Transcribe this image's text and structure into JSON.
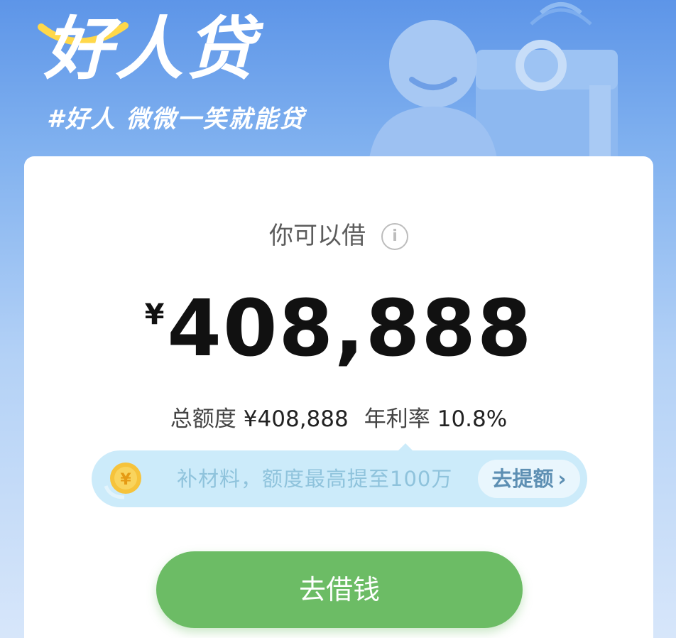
{
  "header": {
    "logo": "好人贷",
    "slogan": "#好人 微微一笑就能贷"
  },
  "loan": {
    "available_label": "你可以借",
    "currency_symbol": "¥",
    "amount": "408,888",
    "total_limit_label": "总额度",
    "total_limit_value": "¥408,888",
    "rate_label": "年利率",
    "rate_value": "10.8%"
  },
  "promo": {
    "text": "补材料，额度最高提至100万",
    "button_label": "去提额",
    "chevron": "›"
  },
  "actions": {
    "borrow_label": "去借钱"
  },
  "icons": {
    "info": "i"
  },
  "colors": {
    "header_blue": "#5d95e8",
    "card_bg": "#ffffff",
    "promo_bg": "#ccebfa",
    "promo_text": "#8fc3dc",
    "promo_button_text": "#5d8fb3",
    "primary_green": "#6cbc65",
    "amount_text": "#111111"
  }
}
